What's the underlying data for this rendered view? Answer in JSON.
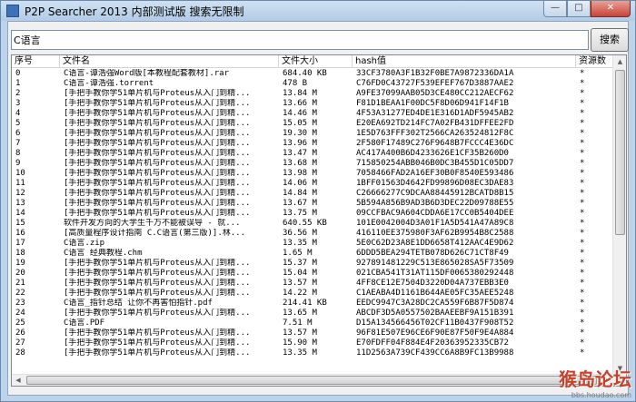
{
  "window": {
    "title": "P2P Searcher 2013 内部测试版 搜索无限制",
    "min_glyph": "—",
    "max_glyph": "□",
    "close_glyph": "✕"
  },
  "search": {
    "value": "C语言",
    "button_label": "搜索"
  },
  "columns": [
    "序号",
    "文件名",
    "文件大小",
    "hash值",
    "资源数"
  ],
  "rows": [
    [
      "0",
      "C语言-谭浩强Word版[本教程配套教材].rar",
      "684.40 KB",
      "33CF3780A3F1B32F0BE7A9872336DA1A",
      "*"
    ],
    [
      "1",
      "C语言-谭浩强.torrent",
      "478 B",
      "C76FD0C43727F539EFEF767D3887AAE2",
      "*"
    ],
    [
      "2",
      "[手把手教你学51单片机与Proteus从入门到精...",
      "13.84 M",
      "A9FE37099AAB05D3CE480CC212AECF62",
      "*"
    ],
    [
      "3",
      "[手把手教你学51单片机与Proteus从入门到精...",
      "13.66 M",
      "F81D1BEAA1F00DC5F8D06D941F14F1B",
      "*"
    ],
    [
      "4",
      "[手把手教你学51单片机与Proteus从入门到精...",
      "14.46 M",
      "4F53A31277ED4DE1E316D1ADF5945AB2",
      "*"
    ],
    [
      "5",
      "[手把手教你学51单片机与Proteus从入门到精...",
      "15.05 M",
      "E20EA692TD214FC7A02FB431DFFEE2FD",
      "*"
    ],
    [
      "6",
      "[手把手教你学51单片机与Proteus从入门到精...",
      "19.30 M",
      "1E5D763FFF302T2566CA263524812F8C",
      "*"
    ],
    [
      "7",
      "[手把手教你学51单片机与Proteus从入门到精...",
      "13.96 M",
      "2F580F17489C276F9648B7FCCC4E36DC",
      "*"
    ],
    [
      "8",
      "[手把手教你学51单片机与Proteus从入门到精...",
      "13.47 M",
      "AC417A400B6D4233626E1CF35B260D0",
      "*"
    ],
    [
      "9",
      "[手把手教你学51单片机与Proteus从入门到精...",
      "13.68 M",
      "715850254ABB046B0DC3B455D1C05DD7",
      "*"
    ],
    [
      "10",
      "[手把手教你学51单片机与Proteus从入门到精...",
      "13.98 M",
      "7058466FAD2A16EF30B0F8540E593486",
      "*"
    ],
    [
      "11",
      "[手把手教你学51单片机与Proteus从入门到精...",
      "14.06 M",
      "1BFF01563D4642FD99896D08EC3DAE83",
      "*"
    ],
    [
      "12",
      "[手把手教你学51单片机与Proteus从入门到精...",
      "14.84 M",
      "C26666277C9DCAA88445912BCATD8B15",
      "*"
    ],
    [
      "13",
      "[手把手教你学51单片机与Proteus从入门到精...",
      "13.67 M",
      "5B594A856B9AD3B6D3DEC22D09788E55",
      "*"
    ],
    [
      "14",
      "[手把手教你学51单片机与Proteus从入门到精...",
      "13.75 M",
      "09CCFBAC9A604CDDA6E17CC0B5404DEE",
      "*"
    ],
    [
      "15",
      "软件开发方向的大学生千万不能被误导 - 就...",
      "640.55 KB",
      "101E0042004D3A01F1A5D541A47A89C8",
      "*"
    ],
    [
      "16",
      "[高质量程序设计指南 C.C语言(第三版)].林...",
      "36.56 M",
      "416110EE375980F3AF62B9954B8C2588",
      "*"
    ],
    [
      "17",
      "C语言.zip",
      "13.35 M",
      "5E0C62D23A8E1DD6658T412AAC4E9D62",
      "*"
    ],
    [
      "18",
      "C语言 经典教程.chm",
      "1.65 M",
      "6DDD5BEA294TETB078D626C71CT8F49",
      "*"
    ],
    [
      "19",
      "[手把手教你学51单片机与Proteus从入门到精...",
      "15.37 M",
      "927891481229C513E865028SA5F73509",
      "*"
    ],
    [
      "20",
      "[手把手教你学51单片机与Proteus从入门到精...",
      "15.04 M",
      "021CBA541T31AT115DF0065380292448",
      "*"
    ],
    [
      "21",
      "[手把手教你学51单片机与Proteus从入门到精...",
      "13.57 M",
      "4FF8CE12E7504D3220D04A737EBB3E0",
      "*"
    ],
    [
      "22",
      "[手把手教你学51单片机与Proteus从入门到精...",
      "14.22 M",
      "C1AEABA4D1161B644AE05FC35AEE5248",
      "*"
    ],
    [
      "23",
      "C语言_指针总结 让你不再害怕指针.pdf",
      "214.41 KB",
      "EEDC9947C3A28DC2CA559F6B87F5D874",
      "*"
    ],
    [
      "24",
      "[手把手教你学51单片机与Proteus从入门到精...",
      "13.65 M",
      "ABCDF3D5A0557502BAAEEBF9A151B391",
      "*"
    ],
    [
      "25",
      "C语言.PDF",
      "7.51 M",
      "D15A134566456T02CF11B0437F908T52",
      "*"
    ],
    [
      "26",
      "[手把手教你学51单片机与Proteus从入门到精...",
      "13.57 M",
      "96F81E507E96CE6F90E87F50F9E4A884",
      "*"
    ],
    [
      "27",
      "[手把手教你学51单片机与Proteus从入门到精...",
      "15.90 M",
      "E70FDFF04F884E4F20363952335CB72",
      "*"
    ],
    [
      "28",
      "[手把手教你学51单片机与Proteus从入门到精...",
      "13.35 M",
      "11D2563A739CF439CC6A8B9FC13B9988",
      "*"
    ]
  ],
  "watermark": {
    "main": "猴岛论坛",
    "sub": "bbs.houdao.com"
  }
}
